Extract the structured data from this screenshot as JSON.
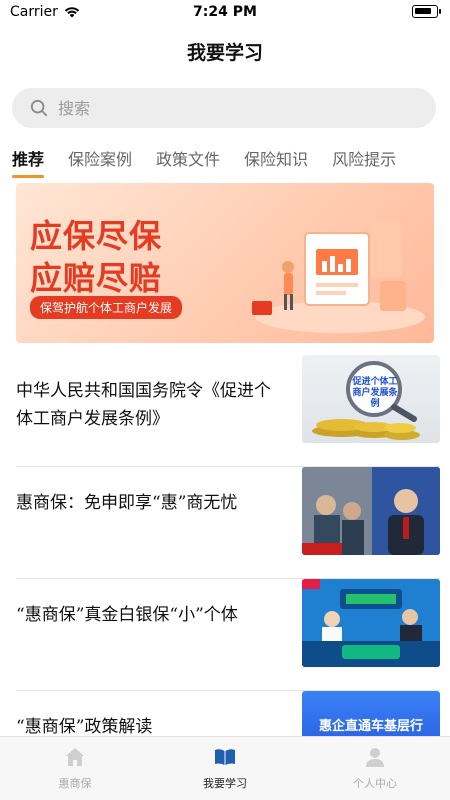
{
  "status_bar": {
    "carrier": "Carrier",
    "time": "7:24 PM"
  },
  "page_title": "我要学习",
  "search": {
    "placeholder": "搜索"
  },
  "tabs": [
    {
      "label": "推荐",
      "active": true
    },
    {
      "label": "保险案例",
      "active": false
    },
    {
      "label": "政策文件",
      "active": false
    },
    {
      "label": "保险知识",
      "active": false
    },
    {
      "label": "风险提示",
      "active": false
    }
  ],
  "banner": {
    "line1": "应保尽保",
    "line2": "应赔尽赔",
    "tagline": "保驾护航个体工商户发展"
  },
  "news": [
    {
      "title": "中华人民共和国国务院令《促进个体工商户发展条例》",
      "thumb_text": "促进个体工商户发展条例"
    },
    {
      "title": "惠商保：免申即享“惠”商无忧",
      "thumb_text": ""
    },
    {
      "title": "“惠商保”真金白银保“小”个体",
      "thumb_text": ""
    },
    {
      "title": "“惠商保”政策解读",
      "thumb_text": "惠企直通车基层行"
    }
  ],
  "tab_bar": [
    {
      "label": "惠商保",
      "icon": "home-icon",
      "active": false
    },
    {
      "label": "我要学习",
      "icon": "book-icon",
      "active": true
    },
    {
      "label": "个人中心",
      "icon": "person-icon",
      "active": false
    }
  ],
  "colors": {
    "accent": "#f0922b",
    "banner_red": "#e43b22",
    "active_tab_icon": "#1f5fb0"
  }
}
